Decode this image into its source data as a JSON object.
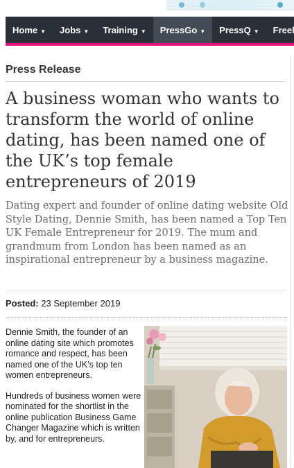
{
  "nav": {
    "items": [
      {
        "label": "Home",
        "active": false
      },
      {
        "label": "Jobs",
        "active": false
      },
      {
        "label": "Training",
        "active": false
      },
      {
        "label": "PressGo",
        "active": true
      },
      {
        "label": "PressQ",
        "active": false
      },
      {
        "label": "Freelan",
        "active": false
      }
    ],
    "caret_icon": "caret-down-icon",
    "bar_color": "#2a2f38",
    "accent_color": "#e0127c"
  },
  "article": {
    "section": "Press Release",
    "headline": "A business woman who wants to transform the world of online dating, has been named one of the UK’s top female entrepreneurs of 2019",
    "standfirst": "Dating expert and founder of online dating website Old Style Dating, Dennie Smith, has been named a Top Ten UK Female Entrepreneur for 2019. The mum and grandmum from London has been named as an inspirational entrepreneur by a business magazine.",
    "posted_label": "Posted:",
    "posted_date": "23 September 2019",
    "paragraphs": [
      "Dennie Smith, the founder of an online dating site which promotes romance and respect, has been named one of the UK’s top ten women entrepreneurs.",
      "Hundreds of business women were nominated for the shortlist in the online publication Business Game Changer Magazine which is written by, and for entrepreneurs."
    ]
  }
}
